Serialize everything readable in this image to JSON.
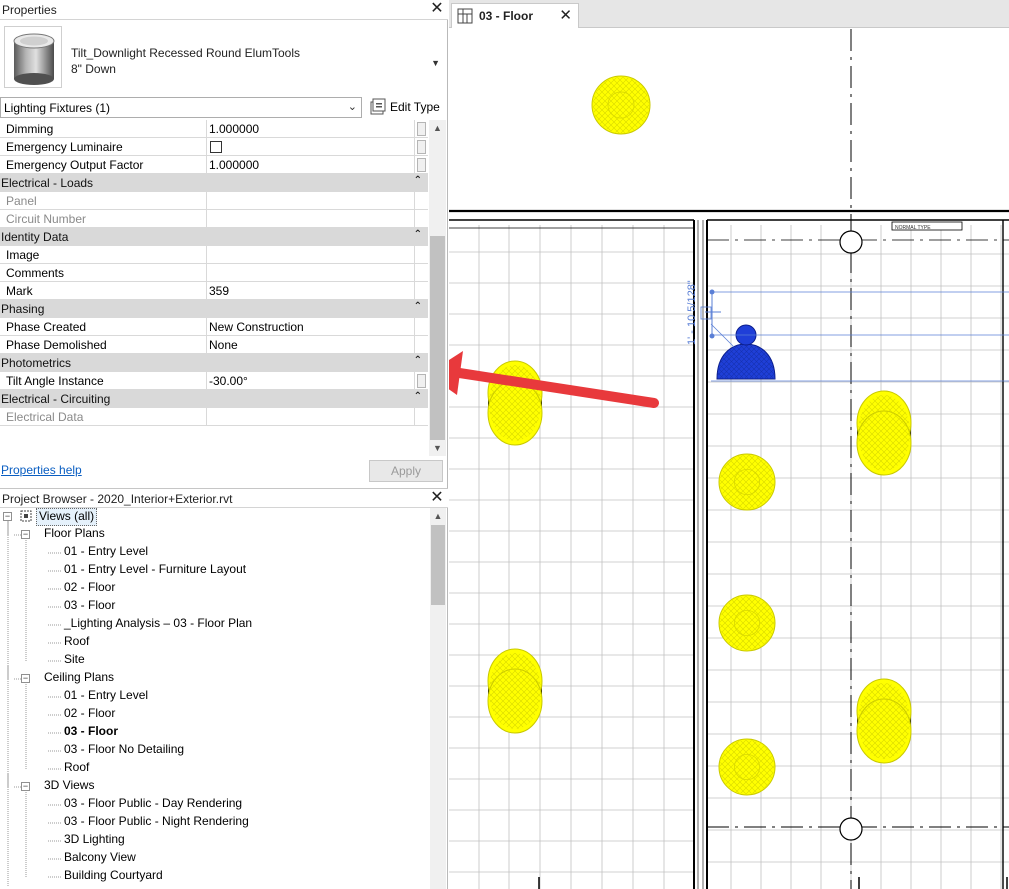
{
  "properties": {
    "title": "Properties",
    "type_name_line1": "Tilt_Downlight Recessed Round ElumTools",
    "type_name_line2": "8\" Down",
    "filter": "Lighting Fixtures (1)",
    "edit_type": "Edit Type",
    "rows": [
      {
        "kind": "param",
        "name": "Dimming",
        "value": "1.000000",
        "dimmed": false
      },
      {
        "kind": "param",
        "name": "Emergency Luminaire",
        "value": "",
        "checkbox": true,
        "checked": false
      },
      {
        "kind": "param",
        "name": "Emergency Output Factor",
        "value": "1.000000"
      },
      {
        "kind": "group",
        "name": "Electrical - Loads"
      },
      {
        "kind": "param",
        "name": "Panel",
        "value": "",
        "dimmed": true
      },
      {
        "kind": "param",
        "name": "Circuit Number",
        "value": "",
        "dimmed": true
      },
      {
        "kind": "group",
        "name": "Identity Data"
      },
      {
        "kind": "param",
        "name": "Image",
        "value": ""
      },
      {
        "kind": "param",
        "name": "Comments",
        "value": ""
      },
      {
        "kind": "param",
        "name": "Mark",
        "value": "359"
      },
      {
        "kind": "group",
        "name": "Phasing"
      },
      {
        "kind": "param",
        "name": "Phase Created",
        "value": "New Construction"
      },
      {
        "kind": "param",
        "name": "Phase Demolished",
        "value": "None"
      },
      {
        "kind": "group",
        "name": "Photometrics"
      },
      {
        "kind": "param",
        "name": "Tilt Angle Instance",
        "value": "-30.00°"
      },
      {
        "kind": "group",
        "name": "Electrical - Circuiting"
      },
      {
        "kind": "param",
        "name": "Electrical Data",
        "value": "",
        "dimmed": true
      }
    ],
    "help_link": "Properties help",
    "apply": "Apply"
  },
  "browser": {
    "title": "Project Browser - 2020_Interior+Exterior.rvt",
    "root": "Views (all)",
    "groups": [
      {
        "label": "Floor Plans",
        "items": [
          "01 - Entry Level",
          "01 - Entry Level - Furniture Layout",
          "02 - Floor",
          "03 - Floor",
          "_Lighting Analysis – 03 - Floor Plan",
          "Roof",
          "Site"
        ]
      },
      {
        "label": "Ceiling Plans",
        "items": [
          "01 - Entry Level",
          "02 - Floor",
          "03 - Floor",
          "03 - Floor No Detailing",
          "Roof"
        ]
      },
      {
        "label": "3D Views",
        "items": [
          "03 - Floor Public - Day Rendering",
          "03 - Floor Public - Night Rendering",
          "3D Lighting",
          "Balcony View",
          "Building Courtyard"
        ]
      }
    ],
    "selected": "Ceiling Plans/03 - Floor"
  },
  "view_tab": {
    "label": "03 - Floor"
  },
  "drawing": {
    "dimension_text": "1' - 10 5/128\"",
    "tag_text": "NORMAL TYPE",
    "colors": {
      "fixture": "#ffff00",
      "selected": "#1f3fd8",
      "arrow": "#e8393c",
      "grid": "#c0c0c0",
      "dim": "#5a7fd6"
    }
  }
}
